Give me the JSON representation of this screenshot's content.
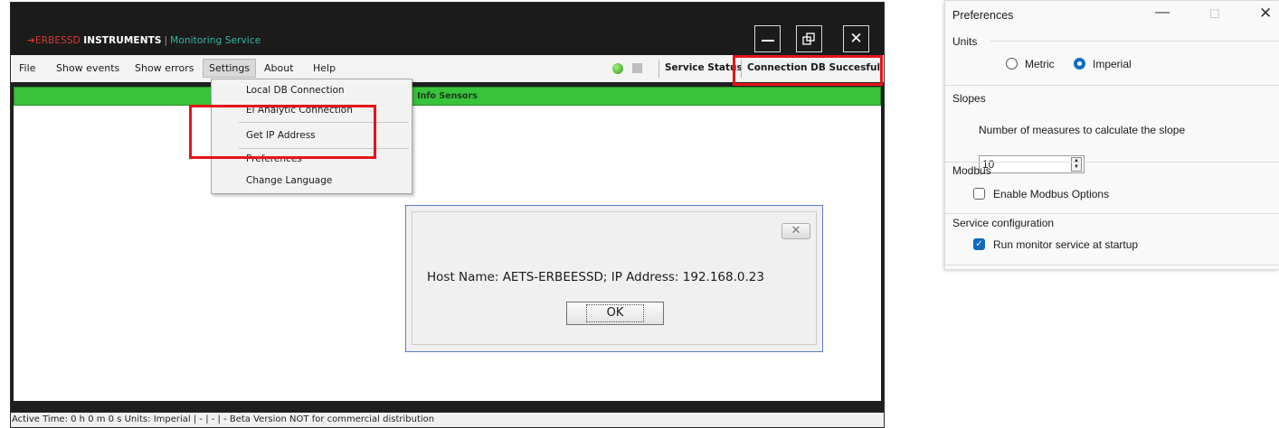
{
  "app": {
    "logo": {
      "brand_red": "ERBESSD",
      "brand_white": "INSTRUMENTS",
      "service": "Monitoring Service"
    },
    "window_buttons": {
      "close_glyph": "✕"
    },
    "menu": [
      "File",
      "Show events",
      "Show errors",
      "Settings",
      "About",
      "Help"
    ],
    "service_status": "Service Status",
    "connection_status": "Connection DB Succesfull",
    "header": "Info Sensors",
    "settings_menu": [
      "Local DB Connection",
      "El Analytic Connection",
      "Get IP Address",
      "Preferences",
      "Change Language"
    ],
    "status_bar": "Active Time:  0 h 0 m 0 s  Units: Imperial  |  -  |  -  |  - Beta Version NOT for commercial distribution"
  },
  "dialog": {
    "message": "Host Name: AETS-ERBEESSD; IP Address: 192.168.0.23",
    "ok": "OK",
    "close": "✕"
  },
  "preferences": {
    "title": "Preferences",
    "units": {
      "label": "Units",
      "options": [
        "Metric",
        "Imperial"
      ],
      "selected": "Imperial"
    },
    "slopes": {
      "label": "Slopes",
      "description": "Number of measures to calculate the slope",
      "value": "10"
    },
    "modbus": {
      "label": "Modbus",
      "option": "Enable Modbus Options",
      "checked": false
    },
    "service": {
      "label": "Service configuration",
      "option": "Run monitor service at startup",
      "checked": true
    }
  },
  "colors": {
    "highlight": "#e5141b",
    "green_header": "#38c33a",
    "accent": "#0f6cbd"
  }
}
